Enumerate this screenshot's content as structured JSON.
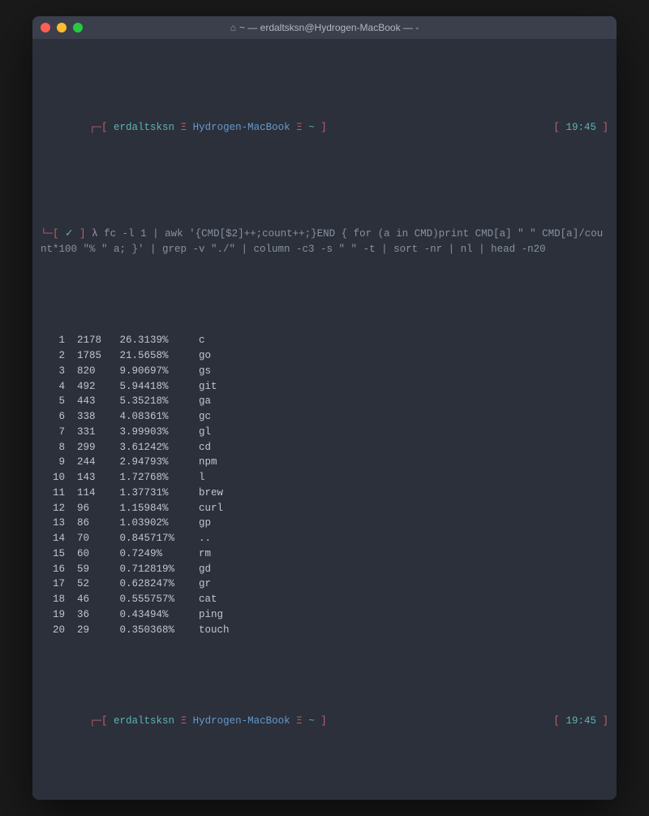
{
  "window": {
    "title": "~ — erdaltsksn@Hydrogen-MacBook — -"
  },
  "prompt1": {
    "user": "erdaltsksn",
    "host": "Hydrogen-MacBook",
    "path": "~",
    "time": "19:45",
    "lbr": "┌─[",
    "rbr": "]",
    "sep_space": " ",
    "xi": "Ξ",
    "lbr2": "└─[",
    "check": "✓",
    "lambda": "λ"
  },
  "command": "fc -l 1 | awk '{CMD[$2]++;count++;}END { for (a in CMD)print CMD[a] \" \" CMD[a]/count*100 \"% \" a; }' | grep -v \"./\" | column -c3 -s \" \" -t | sort -nr | nl | head -n20",
  "rows": [
    {
      "rank": "1",
      "count": "2178",
      "pct": "26.3139%",
      "cmd": "c"
    },
    {
      "rank": "2",
      "count": "1785",
      "pct": "21.5658%",
      "cmd": "go"
    },
    {
      "rank": "3",
      "count": "820",
      "pct": "9.90697%",
      "cmd": "gs"
    },
    {
      "rank": "4",
      "count": "492",
      "pct": "5.94418%",
      "cmd": "git"
    },
    {
      "rank": "5",
      "count": "443",
      "pct": "5.35218%",
      "cmd": "ga"
    },
    {
      "rank": "6",
      "count": "338",
      "pct": "4.08361%",
      "cmd": "gc"
    },
    {
      "rank": "7",
      "count": "331",
      "pct": "3.99903%",
      "cmd": "gl"
    },
    {
      "rank": "8",
      "count": "299",
      "pct": "3.61242%",
      "cmd": "cd"
    },
    {
      "rank": "9",
      "count": "244",
      "pct": "2.94793%",
      "cmd": "npm"
    },
    {
      "rank": "10",
      "count": "143",
      "pct": "1.72768%",
      "cmd": "l"
    },
    {
      "rank": "11",
      "count": "114",
      "pct": "1.37731%",
      "cmd": "brew"
    },
    {
      "rank": "12",
      "count": "96",
      "pct": "1.15984%",
      "cmd": "curl"
    },
    {
      "rank": "13",
      "count": "86",
      "pct": "1.03902%",
      "cmd": "gp"
    },
    {
      "rank": "14",
      "count": "70",
      "pct": "0.845717%",
      "cmd": ".."
    },
    {
      "rank": "15",
      "count": "60",
      "pct": "0.7249%",
      "cmd": "rm"
    },
    {
      "rank": "16",
      "count": "59",
      "pct": "0.712819%",
      "cmd": "gd"
    },
    {
      "rank": "17",
      "count": "52",
      "pct": "0.628247%",
      "cmd": "gr"
    },
    {
      "rank": "18",
      "count": "46",
      "pct": "0.555757%",
      "cmd": "cat"
    },
    {
      "rank": "19",
      "count": "36",
      "pct": "0.43494%",
      "cmd": "ping"
    },
    {
      "rank": "20",
      "count": "29",
      "pct": "0.350368%",
      "cmd": "touch"
    }
  ],
  "prompt2": {
    "user": "erdaltsksn",
    "host": "Hydrogen-MacBook",
    "path": "~",
    "time": "19:45"
  }
}
